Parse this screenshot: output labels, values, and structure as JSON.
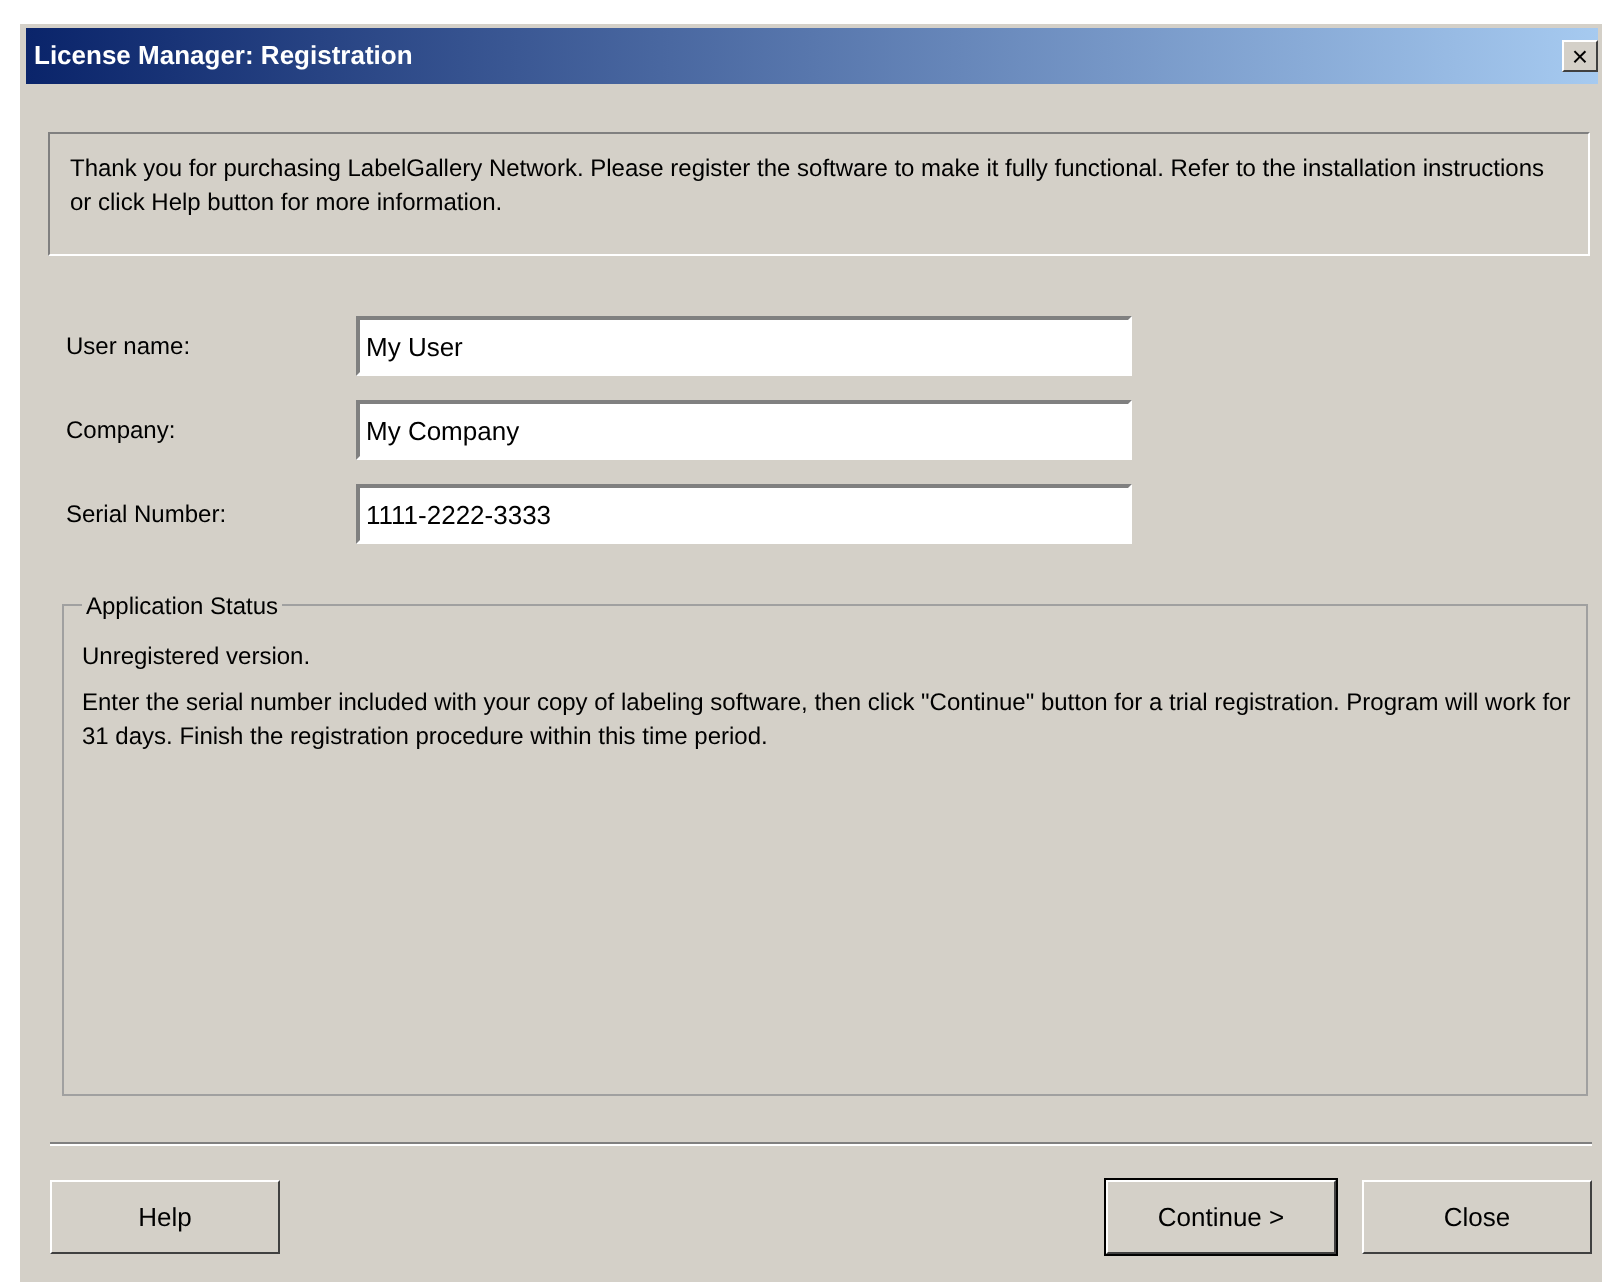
{
  "window": {
    "title": "License Manager: Registration",
    "close_glyph": "×"
  },
  "intro": "Thank you for purchasing LabelGallery Network. Please register the software to make it fully functional. Refer to the installation instructions or click Help button for more information.",
  "fields": [
    {
      "label": "User name:",
      "value": "My User"
    },
    {
      "label": "Company:",
      "value": "My Company"
    },
    {
      "label": "Serial Number:",
      "value": "1111-2222-3333"
    }
  ],
  "status_group": {
    "title": "Application Status",
    "status": "Unregistered version.",
    "message": "Enter the serial number included with your copy of labeling software, then click \"Continue\" button for a trial registration. Program will work for 31 days. Finish the registration procedure within this time period."
  },
  "left_buttons": [
    {
      "label": "Help",
      "default": false
    }
  ],
  "right_buttons": [
    {
      "label": "Continue >",
      "default": true
    },
    {
      "label": "Close",
      "default": false
    }
  ]
}
